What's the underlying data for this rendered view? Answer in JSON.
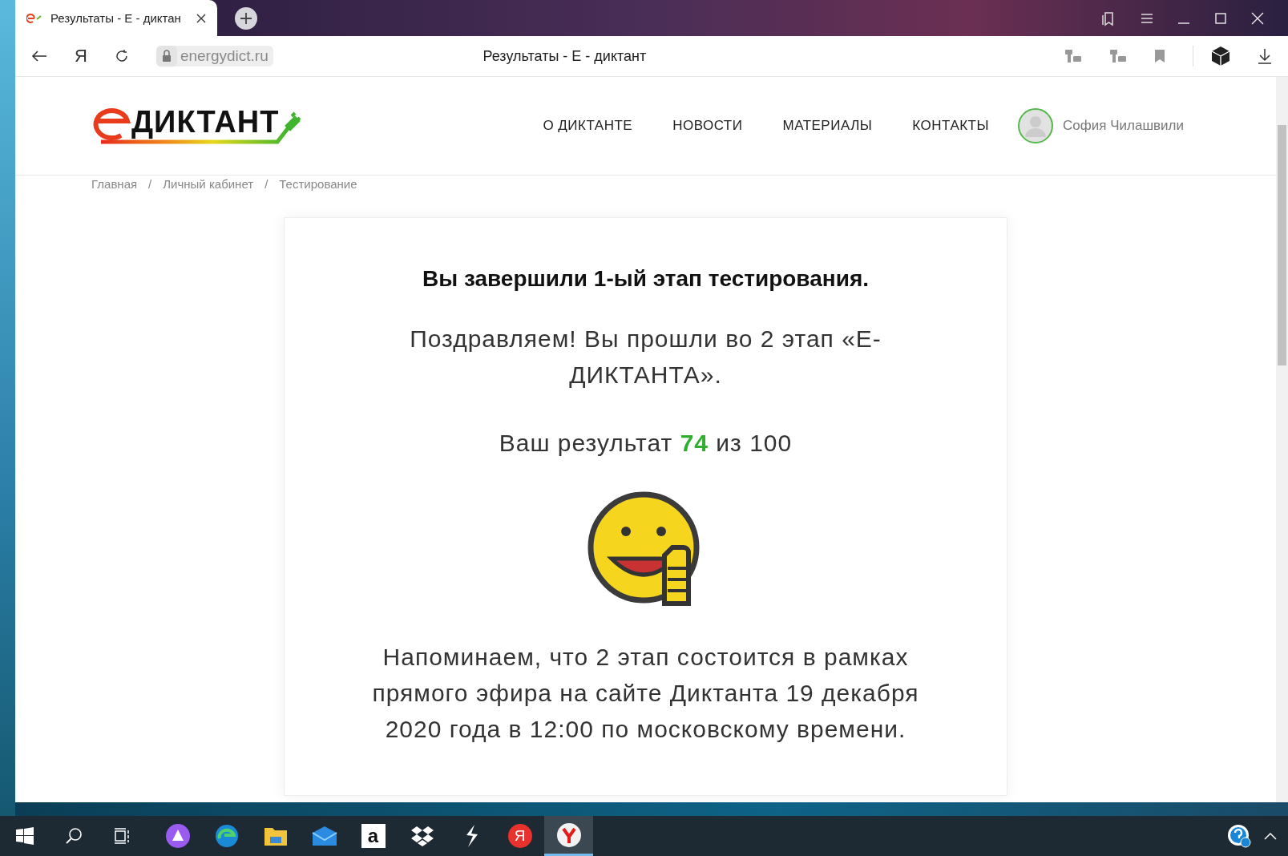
{
  "browser": {
    "tab": {
      "title": "Результаты - Е - диктан",
      "selected": true
    },
    "toolbar_glyph": "Я",
    "address": "energydict.ru",
    "page_title": "Результаты - Е - диктант"
  },
  "site": {
    "logo_text": "ДИКТАНТ",
    "nav": [
      "О ДИКТАНТЕ",
      "НОВОСТИ",
      "МАТЕРИАЛЫ",
      "КОНТАКТЫ"
    ],
    "user": "София Чилашвили"
  },
  "breadcrumb": {
    "items": [
      "Главная",
      "Личный кабинет",
      "Тестирование"
    ],
    "separator": "/"
  },
  "result": {
    "heading": "Вы завершили 1-ый этап тестирования.",
    "congrats": "Поздравляем! Вы прошли во 2 этап «Е-ДИКТАНТА».",
    "score": "Ваш результат **74** из 100",
    "reminder": "Напоминаем, что 2 этап состоится в рамках прямого эфира на сайте Диктанта 19 декабря 2020 года в 12:00 по московскому времени."
  },
  "taskbar": {
    "apps": [
      {
        "kind": "start",
        "selected": false
      },
      {
        "kind": "search",
        "selected": false
      },
      {
        "kind": "taskview",
        "selected": false
      },
      {
        "kind": "alice",
        "selected": false
      },
      {
        "kind": "edge",
        "selected": false
      },
      {
        "kind": "folder",
        "selected": false
      },
      {
        "kind": "mail",
        "selected": false
      },
      {
        "kind": "amazon",
        "label": "a",
        "selected": false
      },
      {
        "kind": "dropbox",
        "selected": false
      },
      {
        "kind": "lightning",
        "selected": false
      },
      {
        "kind": "yandex",
        "label": "Я",
        "selected": false
      },
      {
        "kind": "browser",
        "selected": true
      }
    ]
  }
}
